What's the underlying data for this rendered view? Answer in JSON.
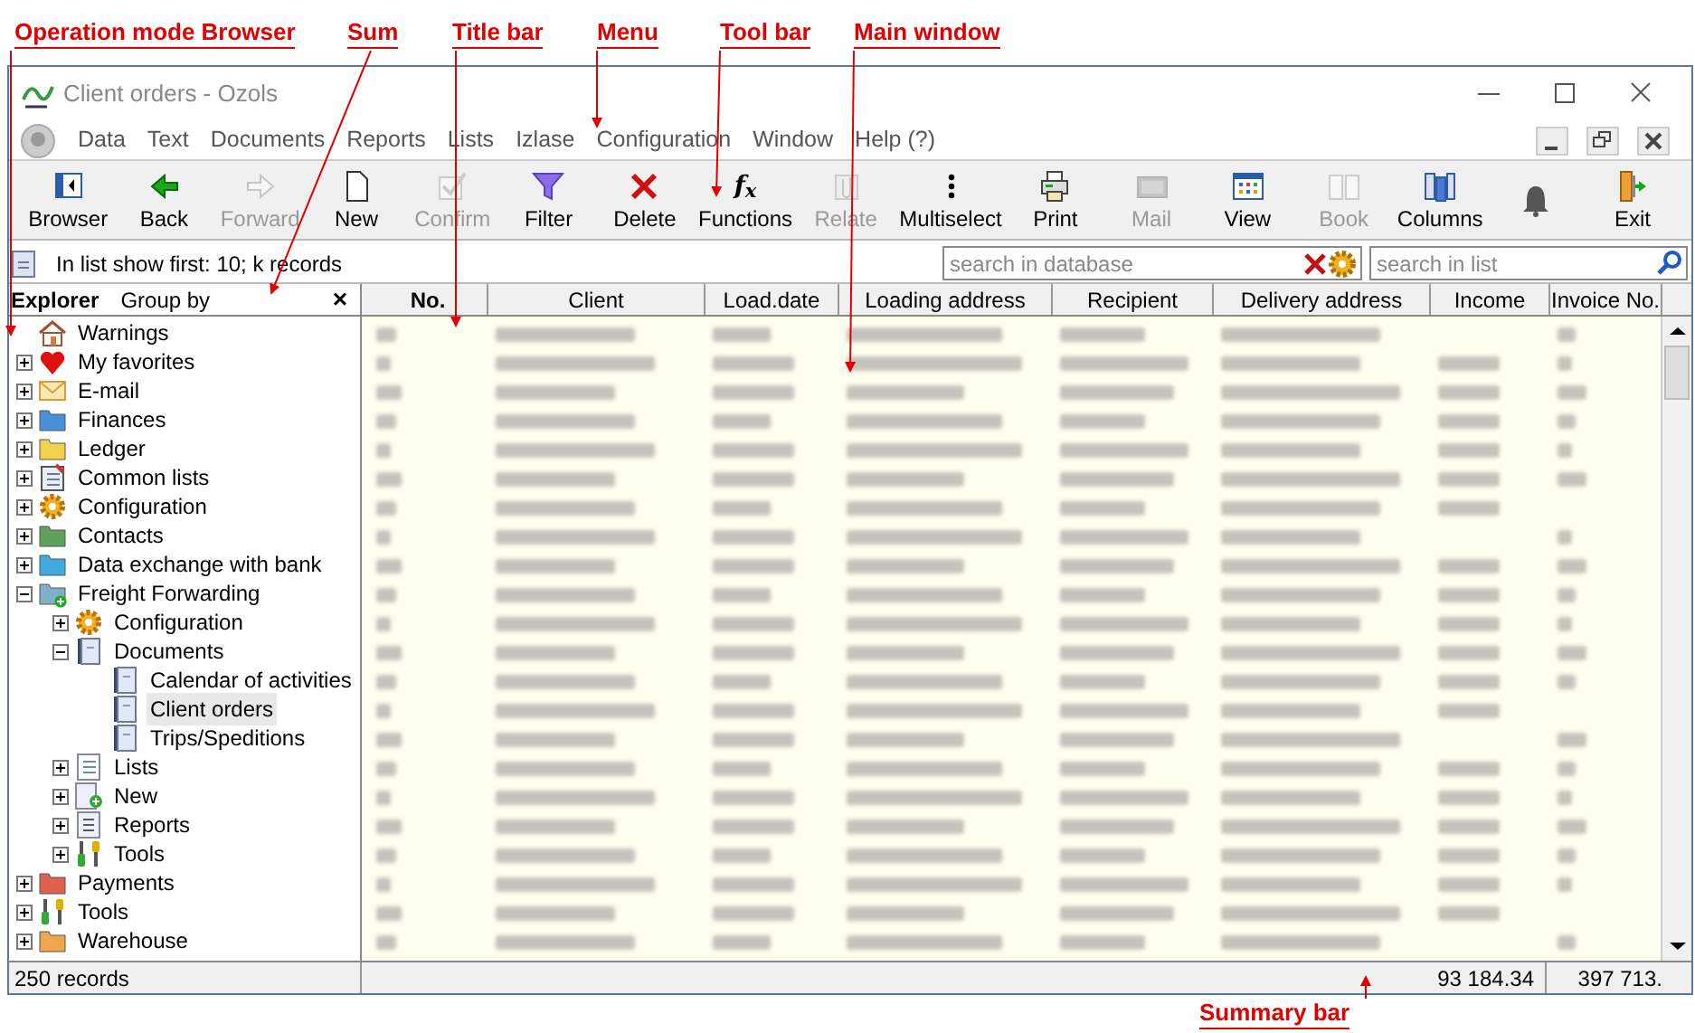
{
  "annotations": [
    {
      "label": "Operation mode Browser"
    },
    {
      "label": "Sum"
    },
    {
      "label": "Title bar"
    },
    {
      "label": "Menu"
    },
    {
      "label": "Tool bar"
    },
    {
      "label": "Main window"
    },
    {
      "label": "Summary bar"
    }
  ],
  "window": {
    "title": "Client orders - Ozols"
  },
  "menu": [
    "Data",
    "Text",
    "Documents",
    "Reports",
    "Lists",
    "Izlase",
    "Configuration",
    "Window",
    "Help (?)"
  ],
  "toolbar": [
    {
      "label": "Browser",
      "kind": "browser",
      "disabled": false
    },
    {
      "label": "Back",
      "kind": "back",
      "disabled": false
    },
    {
      "label": "Forward",
      "kind": "forward",
      "disabled": true
    },
    {
      "label": "New",
      "kind": "new",
      "disabled": false
    },
    {
      "label": "Confirm",
      "kind": "confirm",
      "disabled": true
    },
    {
      "label": "Filter",
      "kind": "filter",
      "disabled": false
    },
    {
      "label": "Delete",
      "kind": "delete",
      "disabled": false
    },
    {
      "label": "Functions",
      "kind": "functions",
      "icon_text": "f$_{x}$",
      "disabled": false
    },
    {
      "label": "Relate",
      "kind": "relate",
      "disabled": true
    },
    {
      "label": "Multiselect",
      "kind": "multiselect",
      "disabled": false
    },
    {
      "label": "Print",
      "kind": "print",
      "disabled": false
    },
    {
      "label": "Mail",
      "kind": "mail",
      "disabled": true
    },
    {
      "label": "View",
      "kind": "view",
      "disabled": false
    },
    {
      "label": "Book",
      "kind": "book",
      "disabled": true
    },
    {
      "label": "Columns",
      "kind": "columns",
      "disabled": false
    },
    {
      "kind": "bell",
      "disabled": false
    },
    {
      "label": "Exit",
      "kind": "exit",
      "disabled": false
    }
  ],
  "info_bar": {
    "text": "In list show first: 10; k records"
  },
  "search_database": {
    "placeholder": "search in database"
  },
  "search_list": {
    "placeholder": "search in list"
  },
  "explorer": {
    "title": "Explorer",
    "group_by": "Group by",
    "close": "×",
    "tree": [
      {
        "label": "Warnings",
        "kind": "house",
        "selected": false
      },
      {
        "label": "My favorites",
        "kind": "heart",
        "expanded": false,
        "selected": false
      },
      {
        "label": "E-mail",
        "kind": "mail",
        "expanded": false,
        "selected": false
      },
      {
        "label": "Finances",
        "kind": "folder",
        "color": "#4a90d9",
        "expanded": false,
        "selected": false
      },
      {
        "label": "Ledger",
        "kind": "folder",
        "color": "#f2d24b",
        "expanded": false,
        "selected": false
      },
      {
        "label": "Common lists",
        "kind": "notebook",
        "expanded": false,
        "selected": false
      },
      {
        "label": "Configuration",
        "kind": "gear",
        "expanded": false,
        "selected": false
      },
      {
        "label": "Contacts",
        "kind": "folder",
        "color": "#5fa15a",
        "expanded": false,
        "selected": false
      },
      {
        "label": "Data exchange with bank",
        "kind": "folder",
        "color": "#3fa9e0",
        "expanded": false,
        "selected": false
      },
      {
        "label": "Freight Forwarding",
        "kind": "folderplus",
        "expanded": true,
        "selected": false,
        "children": [
          {
            "label": "Configuration",
            "kind": "gear",
            "expanded": false,
            "selected": false
          },
          {
            "label": "Documents",
            "kind": "document",
            "expanded": true,
            "selected": false,
            "children": [
              {
                "label": "Calendar of activities",
                "kind": "document",
                "selected": false
              },
              {
                "label": "Client orders",
                "kind": "document",
                "selected": true
              },
              {
                "label": "Trips/Speditions",
                "kind": "document",
                "selected": false
              }
            ]
          },
          {
            "label": "Lists",
            "kind": "lists",
            "expanded": false,
            "selected": false
          },
          {
            "label": "New",
            "kind": "new",
            "expanded": false,
            "selected": false
          },
          {
            "label": "Reports",
            "kind": "report",
            "expanded": false,
            "selected": false
          },
          {
            "label": "Tools",
            "kind": "tools",
            "expanded": false,
            "selected": false
          }
        ]
      },
      {
        "label": "Payments",
        "kind": "folder",
        "color": "#e0604f",
        "expanded": false,
        "selected": false
      },
      {
        "label": "Tools",
        "kind": "tools",
        "expanded": false,
        "selected": false
      },
      {
        "label": "Warehouse",
        "kind": "folder",
        "color": "#eea74e",
        "expanded": false,
        "selected": false
      }
    ]
  },
  "table": {
    "columns": [
      {
        "label": "No.",
        "sorted": true
      },
      {
        "label": "Client",
        "sorted": false
      },
      {
        "label": "Load.date",
        "sorted": false
      },
      {
        "label": "Loading address",
        "sorted": false
      },
      {
        "label": "Recipient",
        "sorted": false
      },
      {
        "label": "Delivery address",
        "sorted": false
      },
      {
        "label": "Income",
        "sorted": false
      },
      {
        "label": "Invoice No.",
        "sorted": false
      }
    ]
  },
  "status_bar": {
    "records": "250 records",
    "sum_1": "93 184.34",
    "sum_2": "397 713."
  }
}
